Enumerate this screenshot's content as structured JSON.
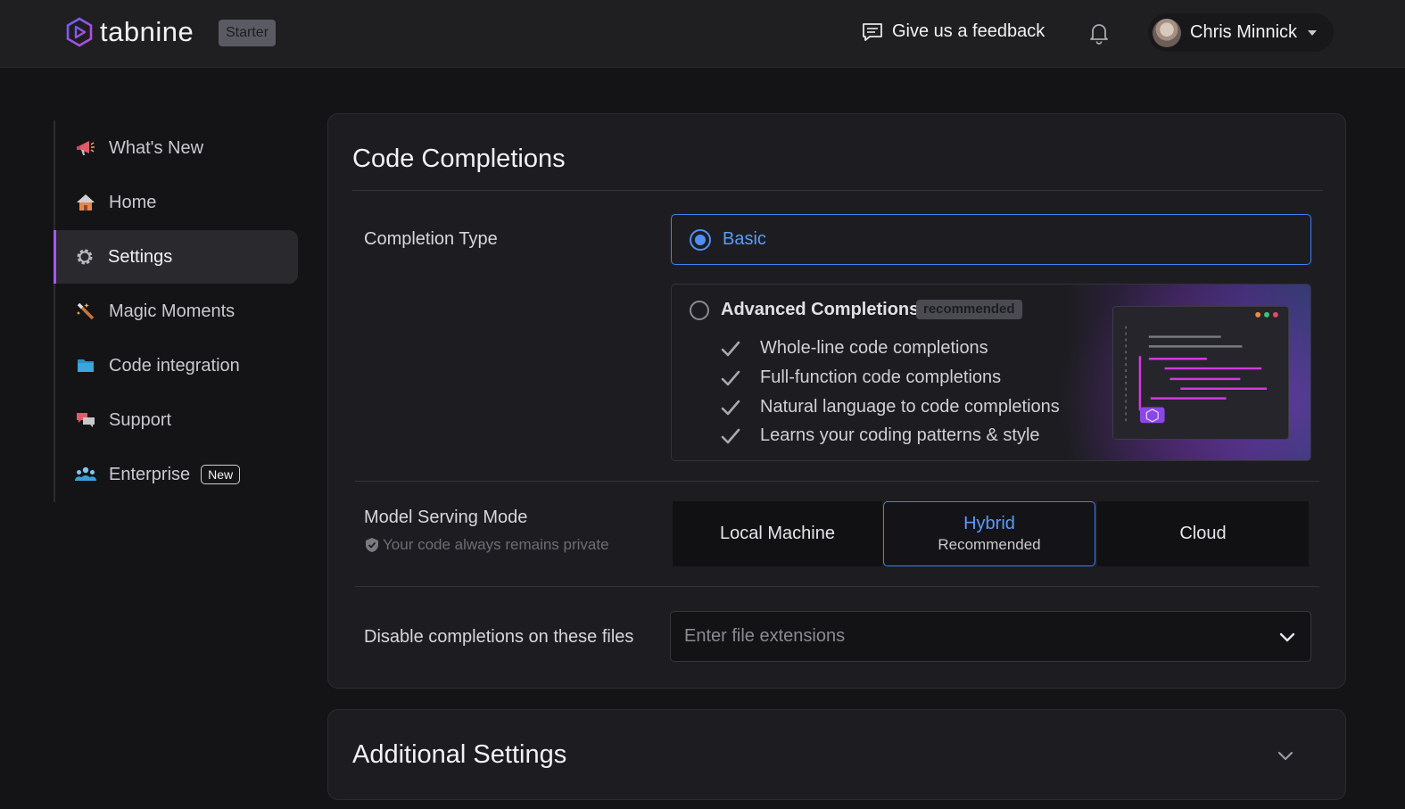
{
  "header": {
    "brand": "tabnine",
    "plan_badge": "Starter",
    "feedback_label": "Give us a feedback",
    "user_name": "Chris Minnick"
  },
  "sidebar": {
    "items": [
      {
        "label": "What's New",
        "icon": "megaphone-icon"
      },
      {
        "label": "Home",
        "icon": "home-icon"
      },
      {
        "label": "Settings",
        "icon": "gear-icon",
        "active": true
      },
      {
        "label": "Magic Moments",
        "icon": "magic-wand-icon"
      },
      {
        "label": "Code integration",
        "icon": "folder-icon"
      },
      {
        "label": "Support",
        "icon": "chat-bubbles-icon"
      },
      {
        "label": "Enterprise",
        "icon": "team-icon",
        "badge": "New"
      }
    ]
  },
  "code_completions": {
    "title": "Code Completions",
    "completion_type": {
      "label": "Completion Type",
      "basic_label": "Basic",
      "advanced_label": "Advanced Completions",
      "advanced_badge": "recommended",
      "features": [
        "Whole-line code completions",
        "Full-function code completions",
        "Natural language to code completions",
        "Learns your coding patterns & style"
      ],
      "selected": "Basic"
    },
    "model_serving": {
      "label": "Model Serving Mode",
      "sublabel": "Your code always remains private",
      "options": [
        {
          "label": "Local Machine"
        },
        {
          "label": "Hybrid",
          "sub": "Recommended",
          "selected": true
        },
        {
          "label": "Cloud"
        }
      ]
    },
    "disable_files": {
      "label": "Disable completions on these files",
      "placeholder": "Enter file extensions"
    }
  },
  "additional_settings": {
    "title": "Additional Settings"
  },
  "colors": {
    "accent_blue": "#3b82f6",
    "accent_purple": "#a855f7",
    "background": "#141417",
    "card": "#1d1d21"
  }
}
